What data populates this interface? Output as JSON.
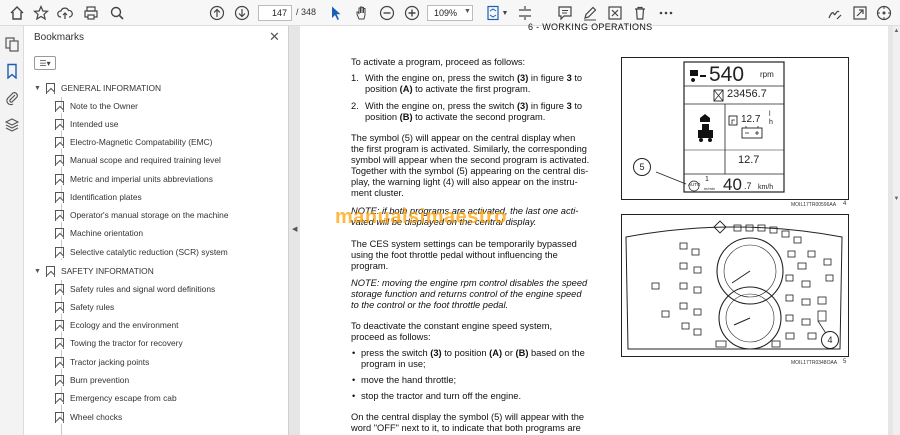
{
  "toolbar": {
    "current_page": "147",
    "total_pages": "/ 348",
    "zoom": "109%"
  },
  "sidebar": {
    "title": "Bookmarks",
    "sections": [
      {
        "label": "GENERAL INFORMATION",
        "items": [
          "Note to the Owner",
          "Intended use",
          "Electro-Magnetic Compatability (EMC)",
          "Manual scope and required training level",
          "Metric and imperial units abbreviations",
          "Identification plates",
          "Operator's manual storage on the machine",
          "Machine orientation",
          "Selective catalytic reduction (SCR) system"
        ]
      },
      {
        "label": "SAFETY INFORMATION",
        "items": [
          "Safety rules and signal word definitions",
          "Safety rules",
          "Ecology and the environment",
          "Towing the tractor for recovery",
          "Tractor jacking points",
          "Burn prevention",
          "Emergency escape from cab",
          "Wheel chocks"
        ]
      }
    ]
  },
  "document": {
    "running_head": "6 - WORKING OPERATIONS",
    "intro": "To activate a program, proceed as follows:",
    "step1": {
      "num": "1.",
      "a": "With the engine on, press the switch ",
      "b": "(3)",
      "c": " in figure ",
      "d": "3",
      "e": " to",
      "f": "position ",
      "g": "(A)",
      "h": " to activate the first program."
    },
    "step2": {
      "num": "2.",
      "a": "With the engine on, press the switch ",
      "b": "(3)",
      "c": " in figure ",
      "d": "3",
      "e": " to",
      "f": "position ",
      "g": "(B)",
      "h": " to activate the second program."
    },
    "para1": [
      "The symbol (5) will appear on the central display when",
      "the first program is activated. Similarly, the corresponding",
      "symbol will appear when the second program is activated.",
      "Together with the symbol (5) appearing on the central dis-",
      "play, the warning light (4) will also appear on the instru-",
      "ment cluster."
    ],
    "note1": [
      "NOTE: if both programs are activated, the last one acti-",
      "vated will be displayed on the central display."
    ],
    "para2": [
      "The CES system settings can be temporarily bypassed",
      "using the foot throttle pedal without influencing the",
      "program."
    ],
    "note2": [
      "NOTE: moving the engine rpm control disables the speed",
      "storage function and returns control of the engine speed",
      "to the control or the foot throttle pedal."
    ],
    "para3": [
      "To deactivate the constant engine speed system,",
      "proceed as follows:"
    ],
    "bullets": [
      [
        "press the switch ",
        "(3)",
        " to position ",
        "(A)",
        " or ",
        "(B)",
        " based on the"
      ],
      [
        "program in use;"
      ],
      [
        "move the hand throttle;"
      ],
      [
        "stop the tractor and turn off the engine."
      ]
    ],
    "para4": [
      "On the central display the symbol (5) will appear with the",
      "word \"OFF\" next to it, to indicate that both programs are"
    ]
  },
  "figure1": {
    "rpm_value": "540",
    "rpm_unit": "rpm",
    "hours_value": "23456.7",
    "fuel_rate": "12.7",
    "fuel_unit_top": "l",
    "fuel_unit_bottom": "h",
    "battery_value": "12.7",
    "callout": "5",
    "auto_label": "AUTO",
    "auto_value": "1",
    "auto_unit": "m/min",
    "speed_value": "40",
    "speed_decimal": ".7",
    "speed_unit": "km/h",
    "caption": "MOIL17TR00596AA",
    "fig_number": "4"
  },
  "figure2": {
    "callout": "4",
    "caption": "MOIL17TR0348OAA",
    "fig_number": "5"
  },
  "watermark": "manualsimaestro"
}
